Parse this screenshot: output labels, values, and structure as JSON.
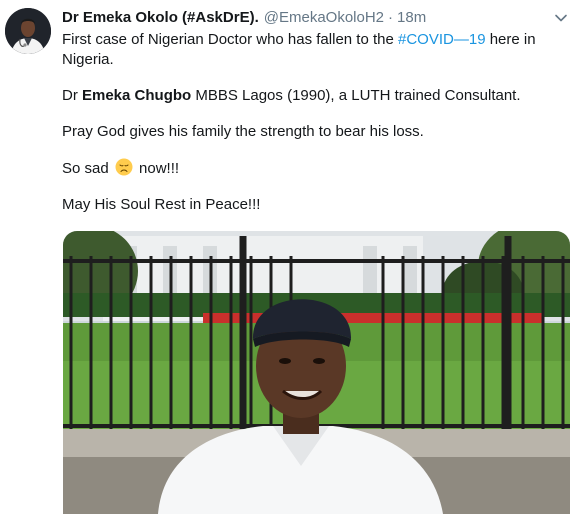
{
  "author": {
    "display_name": "Dr Emeka Okolo (#AskDrE).",
    "handle": "@EmekaOkoloH2",
    "separator": "·",
    "time": "18m"
  },
  "tweet": {
    "line1_pre": "First case of Nigerian Doctor who has fallen to the ",
    "hashtag": "#COVID—19",
    "line1_post": " here in Nigeria.",
    "line2_pre": "Dr ",
    "line2_bold": "Emeka Chugbo",
    "line2_post": " MBBS Lagos (1990), a LUTH trained Consultant.",
    "line3": "Pray God gives his family the strength to bear his loss.",
    "line4_pre": "So sad ",
    "line4_post": " now!!!",
    "line5": "May His Soul Rest in Peace!!!"
  },
  "icons": {
    "avatar": "doctor-avatar",
    "emoji": "disappointed-face-emoji",
    "menu": "chevron-down-icon"
  },
  "colors": {
    "link": "#1b95e0",
    "secondary_text": "#657786",
    "primary_text": "#14171a",
    "emoji_yellow": "#ffcc4d"
  }
}
